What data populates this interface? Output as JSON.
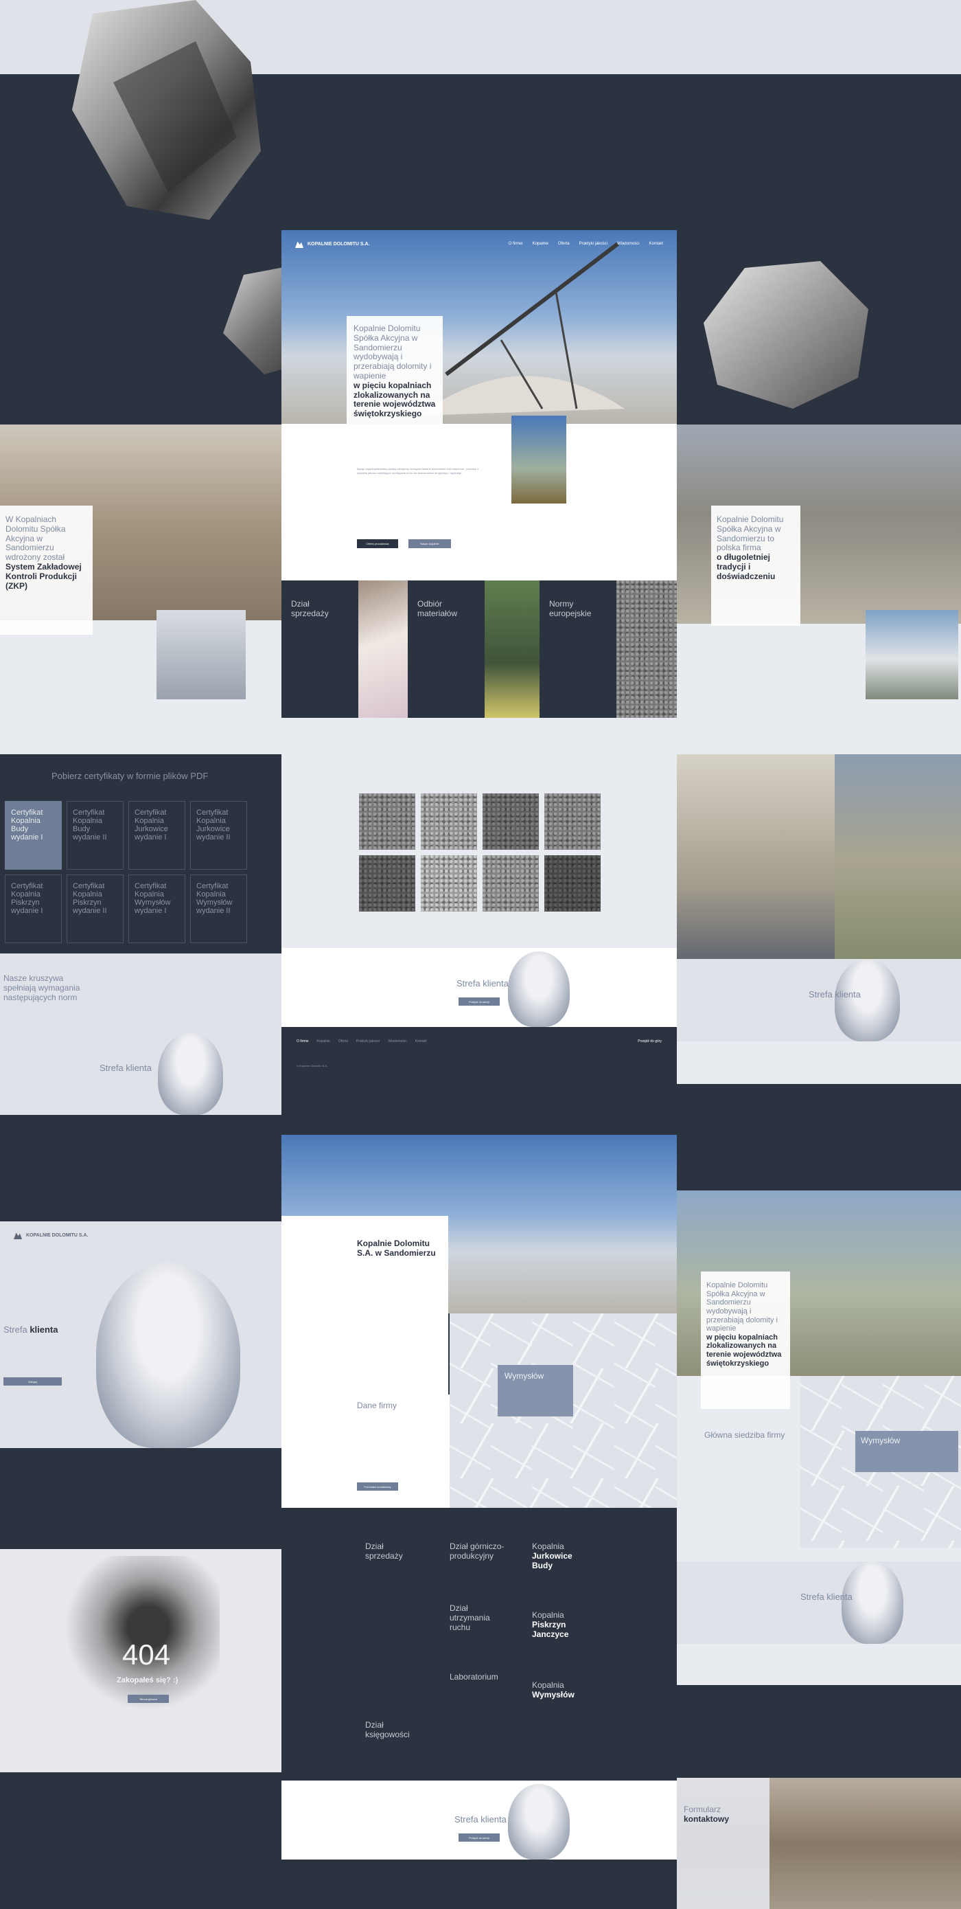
{
  "brand": {
    "name": "KOPALNIE DOLOMITU S.A."
  },
  "nav": {
    "items": [
      "O firmie",
      "Kopalnie",
      "Oferta",
      "Praktyki jakości",
      "Wiadomości",
      "Kontakt"
    ]
  },
  "hero_main": {
    "light": "Kopalnie Dolomitu Spółka Akcyjna w Sandomierzu wydobywają i przerabiają dolomity i wapienie",
    "bold": "w pięciu kopalniach zlokalizowanych na terenie województwa świętokrzyskiego",
    "paragraph": "Będąc wyspecjalizowaną spółką oferujemy kruszywa łamane dolomitowe oraz wapienne, produkty o wysokiej jakości spełniające wymagania norm dla budownictwa drogowego i ogólnego.",
    "btn_offer": "Oferta produktowa",
    "btn_mines": "Nasze kopalnie"
  },
  "sales": {
    "dzial_light": "Dział sprzedaży",
    "odbior_light": "Odbiór materiałów",
    "normy_light": "Normy europejskie"
  },
  "client_zone": {
    "title": "Strefa klienta",
    "button": "Przejdź do strefy"
  },
  "footer": {
    "items": [
      "O firmie",
      "Kopalnie",
      "Oferta",
      "Praktyki jakości",
      "Wiadomości",
      "Kontakt"
    ],
    "cta": "Przejdź do góry",
    "copyright": "© Kopalnie Dolomitu S.A."
  },
  "zkp": {
    "light": "W Kopalniach Dolomitu Spółka Akcyjna w Sandomierzu wdrożony został",
    "bold": "System Zakładowej Kontroli Produkcji (ZKP)"
  },
  "certs": {
    "title": "Pobierz certyfikaty w formie plików PDF",
    "items": [
      "Certyfikat Kopalnia Budy wydanie I",
      "Certyfikat Kopalnia Budy wydanie II",
      "Certyfikat Kopalnia Jurkowice wydanie I",
      "Certyfikat Kopalnia Jurkowice wydanie II",
      "Certyfikat Kopalnia Piskrzyn wydanie I",
      "Certyfikat Kopalnia Piskrzyn wydanie II",
      "Certyfikat Kopalnia Wymysłów wydanie I",
      "Certyfikat Kopalnia Wymysłów wydanie II"
    ]
  },
  "norms": {
    "text": "Nasze kruszywa spełniają wymagania następujących norm"
  },
  "client_login": {
    "light": "Strefa",
    "bold": "klienta",
    "button": "Zaloguj"
  },
  "tradition": {
    "light": "Kopalnie Dolomitu Spółka Akcyjna w Sandomierzu to polska firma",
    "bold": "o długoletniej tradycji i doświadczeniu"
  },
  "contact_hero": {
    "bold": "Kopalnie Dolomitu S.A. w Sandomierzu"
  },
  "company_data": {
    "title": "Dane firmy",
    "button": "Formularz kontaktowy"
  },
  "map_card": {
    "title": "Wymysłów"
  },
  "departments": {
    "col1": [
      "Dział sprzedaży",
      "Dział księgowości"
    ],
    "col2": [
      "Dział górniczo-produkcyjny",
      "Dział utrzymania ruchu",
      "Laboratorium"
    ],
    "col3_light": [
      "Kopalnia",
      "Kopalnia",
      "Kopalnia"
    ],
    "col3_bold": [
      "Jurkowice Budy",
      "Piskrzyn Janczyce",
      "Wymysłów"
    ]
  },
  "page404": {
    "code": "404",
    "text": "Zakopałeś się? :)",
    "button": "Strona główna"
  },
  "mines_hero": {
    "light": "Kopalnie Dolomitu Spółka Akcyjna w Sandomierzu wydobywają i przerabiają dolomity i wapienie",
    "bold": "w pięciu kopalniach zlokalizowanych na terenie województwa świętokrzyskiego",
    "seat": "Główna siedziba firmy",
    "map_title": "Wymysłów"
  },
  "contact_form": {
    "light": "Formularz",
    "bold": "kontaktowy"
  }
}
